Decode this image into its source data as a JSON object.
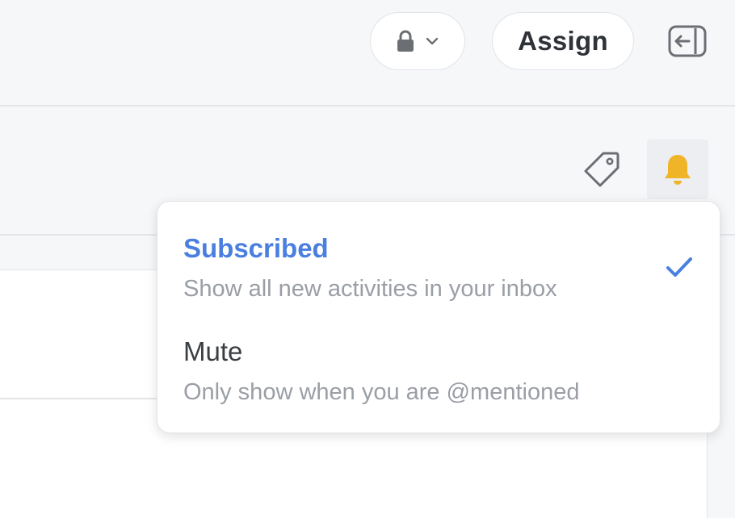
{
  "toolbar": {
    "lock_icon": "lock-icon",
    "dropdown_icon": "chevron-down-icon",
    "assign_label": "Assign",
    "panel_icon": "panel-collapse-icon"
  },
  "header": {
    "tag_icon": "tag-icon",
    "bell_icon": "bell-icon"
  },
  "notification_menu": {
    "options": [
      {
        "title": "Subscribed",
        "description": "Show all new activities in your inbox",
        "selected": true
      },
      {
        "title": "Mute",
        "description": "Only show when you are @mentioned",
        "selected": false
      }
    ]
  },
  "colors": {
    "accent": "#4a7fe0",
    "bell": "#f0b429",
    "muted_text": "#9a9ea5",
    "icon_gray": "#6b6e73"
  }
}
